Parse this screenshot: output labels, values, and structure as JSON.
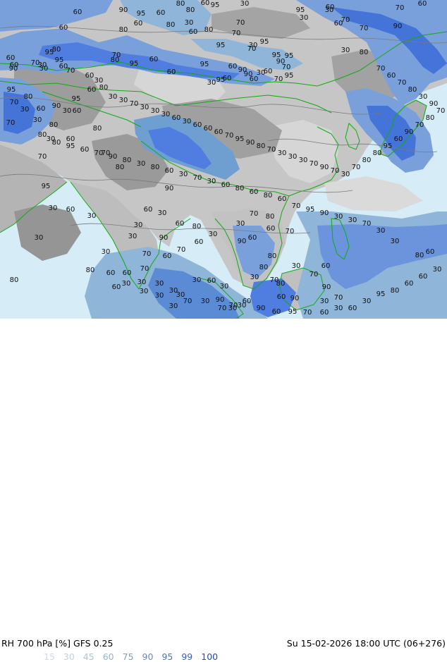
{
  "title": "RH 700 hPa [%] GFS 0.25",
  "valid_time": "Su 15-02-2026 18:00 UTC (06+276)",
  "legend": [
    {
      "label": "15",
      "color": "#c8dced"
    },
    {
      "label": "30",
      "color": "#bcd3e6"
    },
    {
      "label": "45",
      "color": "#a9c6df"
    },
    {
      "label": "60",
      "color": "#8fb5d8"
    },
    {
      "label": "75",
      "color": "#6f9fd0"
    },
    {
      "label": "90",
      "color": "#5b8bd4"
    },
    {
      "label": "95",
      "color": "#4574d8"
    },
    {
      "label": "99",
      "color": "#2f5fe0"
    },
    {
      "label": "100",
      "color": "#1a46e0"
    }
  ],
  "colors": {
    "ocean": "#d6ecf7",
    "dry_gray": "#9a9a9a",
    "mid_gray": "#b9b9b9",
    "light_gray": "#d4d4d4",
    "very_dry": "#8a8a8a",
    "humid_blue": "#6b94dd",
    "saturated_blue": "#3f6fde",
    "coastline": "#11aa11"
  },
  "contour_labels": [
    "90",
    "60",
    "60",
    "95",
    "60",
    "60",
    "80",
    "95",
    "80",
    "30",
    "95",
    "30",
    "70",
    "60",
    "30",
    "60",
    "80",
    "60",
    "80",
    "30",
    "80",
    "60",
    "70",
    "60",
    "70",
    "90",
    "70",
    "70",
    "95",
    "95",
    "80",
    "30",
    "95",
    "60",
    "70",
    "80",
    "60",
    "95",
    "60",
    "95",
    "30",
    "95",
    "30",
    "80",
    "70",
    "95",
    "95",
    "90",
    "60",
    "90",
    "70",
    "30",
    "90",
    "60",
    "30",
    "95",
    "60",
    "70",
    "95",
    "60",
    "60",
    "60",
    "90",
    "70",
    "30",
    "70",
    "60",
    "30",
    "80",
    "60",
    "95",
    "95",
    "80",
    "70",
    "30",
    "60",
    "90",
    "30",
    "60",
    "70",
    "30",
    "80",
    "80",
    "30",
    "60",
    "80",
    "70",
    "80",
    "70",
    "95",
    "90",
    "60",
    "30",
    "30",
    "30",
    "60",
    "30",
    "30",
    "80",
    "30",
    "30",
    "70",
    "60",
    "70",
    "60",
    "90",
    "60",
    "80",
    "30",
    "90",
    "60",
    "60",
    "70",
    "30",
    "70",
    "80",
    "80",
    "80",
    "30",
    "70",
    "30",
    "70",
    "60",
    "90",
    "70",
    "30",
    "90",
    "60",
    "80",
    "70",
    "30",
    "90",
    "30",
    "60",
    "30",
    "30",
    "30",
    "30",
    "30",
    "30",
    "30",
    "60",
    "80",
    "60",
    "60",
    "70",
    "30",
    "30",
    "70",
    "30",
    "70",
    "30",
    "60",
    "90",
    "60",
    "95",
    "70",
    "60",
    "30",
    "60",
    "30",
    "95",
    "80",
    "60",
    "60",
    "30",
    "60",
    "80",
    "30",
    "30",
    "70",
    "30",
    "30",
    "90",
    "95",
    "70",
    "60",
    "80",
    "60",
    "80",
    "60",
    "30",
    "70",
    "30",
    "60",
    "80",
    "30",
    "80",
    "90",
    "70",
    "60",
    "95",
    "80",
    "70",
    "60",
    "70",
    "80",
    "30",
    "90",
    "70",
    "80",
    "70",
    "90",
    "60",
    "95",
    "80",
    "80",
    "70",
    "30",
    "70",
    "90",
    "70",
    "30",
    "30",
    "30",
    "70",
    "80",
    "90",
    "95",
    "70",
    "60",
    "60",
    "60",
    "30",
    "60",
    "30",
    "30",
    "30",
    "70",
    "30",
    "30"
  ]
}
